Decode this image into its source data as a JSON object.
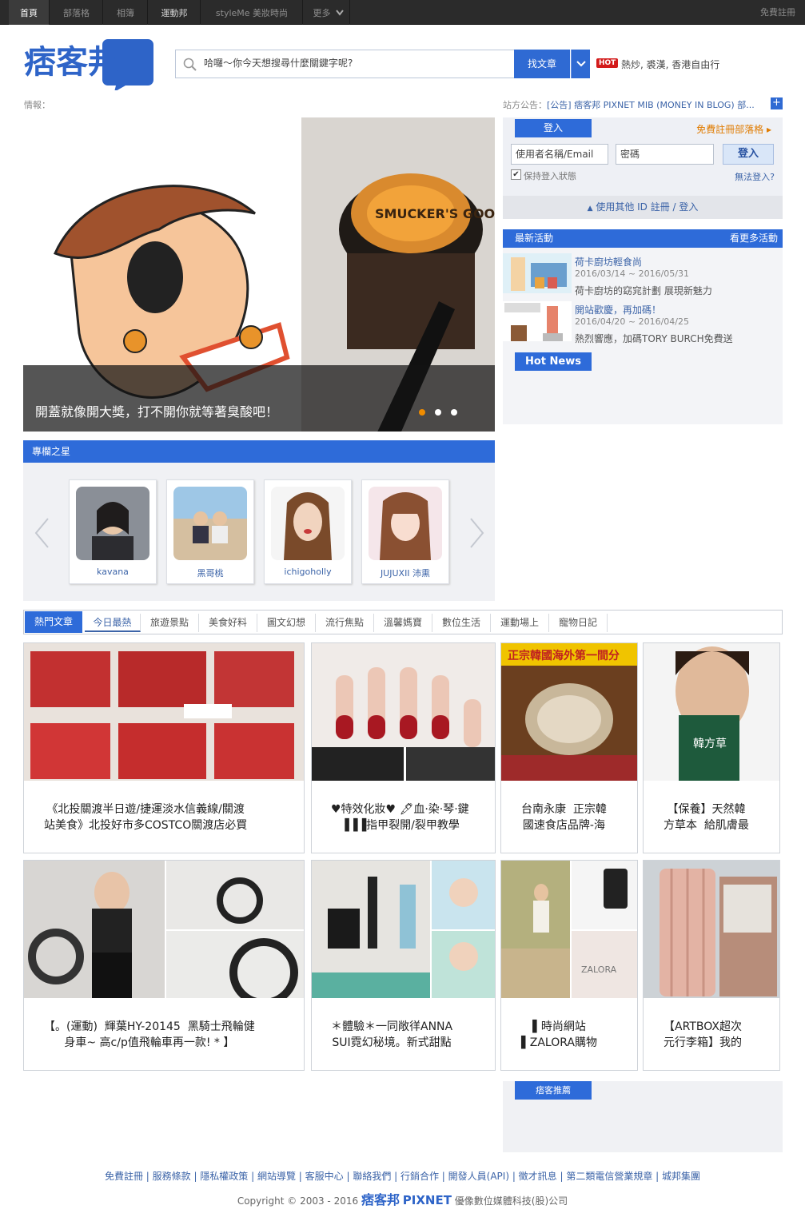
{
  "topnav": {
    "tabs": [
      "首頁",
      "部落格",
      "相簿",
      "運動邦",
      "styleMe 美妝時尚",
      "更多"
    ],
    "register": "免費註冊"
  },
  "header": {
    "logo_text": "痞客邦",
    "search_placeholder": "哈囉～你今天想搜尋什麼關鍵字呢?",
    "search_button": "找文章",
    "hot_badge": "HOT",
    "hot_keywords": "熱炒, 裘漢, 香港自由行"
  },
  "info_label": "情報：",
  "announcement": {
    "label": "站方公告：",
    "text": "[公告] 痞客邦 PIXNET MIB (MONEY IN BLOG) 部..."
  },
  "slider": {
    "caption": "開蓋就像開大獎，打不開你就等著臭酸吧！",
    "jar_label": "SMUCKER'S GOOBER",
    "active_dot": 0,
    "dot_count": 3
  },
  "login": {
    "tab_label": "登入",
    "register_link": "免費註冊部落格",
    "username_placeholder": "使用者名稱/Email",
    "password_placeholder": "密碼",
    "login_button": "登入",
    "remember": "保持登入狀態",
    "forgot": "無法登入?",
    "other_id": "使用其他 ID 註冊 / 登入"
  },
  "activities": {
    "title": "最新活動",
    "more": "看更多活動",
    "items": [
      {
        "title": "荷卡廚坊輕食尚",
        "date": "2016/03/14 ~ 2016/05/31",
        "desc": "荷卡廚坊的窈窕計劃 展現新魅力"
      },
      {
        "title": "開站歡慶，再加碼！",
        "date": "2016/04/20 ~ 2016/04/25",
        "desc": "熱烈響應，加碼TORY BURCH免費送"
      }
    ],
    "hot_news": "Hot News"
  },
  "stars": {
    "title": "專欄之星",
    "items": [
      {
        "name": "kavana"
      },
      {
        "name": "黑哥桃"
      },
      {
        "name": "ichigoholly"
      },
      {
        "name": "JUJUXII 沛熏"
      }
    ]
  },
  "tabs": [
    "熱門文章",
    "今日最熱",
    "旅遊景點",
    "美食好料",
    "圖文幻想",
    "流行焦點",
    "溫馨媽寶",
    "數位生活",
    "運動場上",
    "寵物日記"
  ],
  "articles": [
    {
      "title": "《北投關渡半日遊/捷運淡水信義線/關渡\n站美食》北投好市多COSTCO關渡店必買"
    },
    {
      "title": "♥特效化妝♥ 🖋血·染·琴·鍵\n▐▐▐指甲裂開/裂甲教學"
    },
    {
      "title": "台南永康  正宗韓\n國速食店品牌-海",
      "img_text": "正宗韓國海外第一間分"
    },
    {
      "title": "【保養】天然韓\n方草本  給肌膚最",
      "img_text": "韓方草"
    },
    {
      "title": "【。(運動)  輝葉HY-20145  黑騎士飛輪健\n身車~ 高c/p值飛輪車再一款! * 】"
    },
    {
      "title": "＊體驗＊一同敞徉ANNA\nSUI霓幻秘境。新式甜點"
    },
    {
      "title": "▌時尚網站\n▌ZALORA購物",
      "img_text": "ZALORA"
    },
    {
      "title": "【ARTBOX超次\n元行李箱】我的"
    }
  ],
  "push": {
    "title": "痞客推薦"
  },
  "footer": {
    "links": "免費註冊 | 服務條款 | 隱私權政策 | 網站導覽 | 客服中心 | 聯絡我們 | 行銷合作 | 開發人員(API) | 徵才訊息 | 第二類電信營業規章 | 城邦集團",
    "copyright": "Copyright © 2003 - 2016",
    "brand": "痞客邦",
    "brand_en": "PIXNET",
    "company": "優像數位媒體科技(股)公司"
  }
}
